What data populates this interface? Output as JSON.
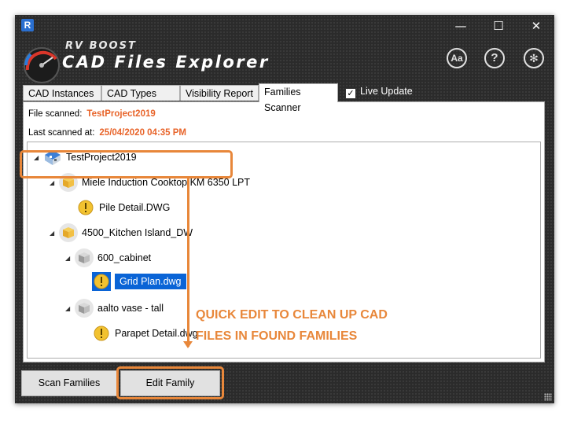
{
  "window": {
    "app_logo": "R",
    "controls": {
      "minimize": "—",
      "maximize": "☐",
      "close": "✕"
    },
    "title_line1": "RV BOOST",
    "title_line2": "CAD Files Explorer",
    "header_icons": [
      {
        "name": "font-size-icon",
        "glyph": "Aa"
      },
      {
        "name": "help-icon",
        "glyph": "?"
      },
      {
        "name": "settings-icon",
        "glyph": "✻"
      }
    ]
  },
  "tabs": [
    {
      "label": "CAD Instances",
      "active": false
    },
    {
      "label": "CAD Types",
      "active": false
    },
    {
      "label": "Visibility Report",
      "active": false
    },
    {
      "label": "Families Scanner",
      "active": true
    }
  ],
  "live_update": {
    "label": "Live Update",
    "checked": true
  },
  "scan_info": {
    "file_label": "File scanned:",
    "file_value": "TestProject2019",
    "time_label": "Last scanned at:",
    "time_value": "25/04/2020 04:35 PM"
  },
  "tree": [
    {
      "label": "TestProject2019",
      "type": "project",
      "expanded": true,
      "level": 0
    },
    {
      "label": "Miele Induction Cooktop KM 6350 LPT",
      "type": "family",
      "expanded": true,
      "level": 1
    },
    {
      "label": "Pile Detail.DWG",
      "type": "cad",
      "level": 2
    },
    {
      "label": "4500_Kitchen Island_DW",
      "type": "family",
      "expanded": true,
      "level": 1
    },
    {
      "label": "600_cabinet",
      "type": "family-grey",
      "expanded": true,
      "level": 2
    },
    {
      "label": "Grid Plan.dwg",
      "type": "cad",
      "level": 3,
      "selected": true
    },
    {
      "label": "aalto vase - tall",
      "type": "family-grey",
      "expanded": true,
      "level": 2
    },
    {
      "label": "Parapet Detail.dwg",
      "type": "cad",
      "level": 3
    }
  ],
  "annotation": {
    "line1": "QUICK EDIT TO CLEAN UP CAD",
    "line2": "FILES IN FOUND FAMILIES",
    "color": "#e8873a"
  },
  "buttons": {
    "scan": "Scan Families",
    "edit": "Edit Family"
  },
  "colors": {
    "accent_orange": "#e8642a",
    "selection_blue": "#0a64d6",
    "window_dark": "#2b2b2b"
  }
}
